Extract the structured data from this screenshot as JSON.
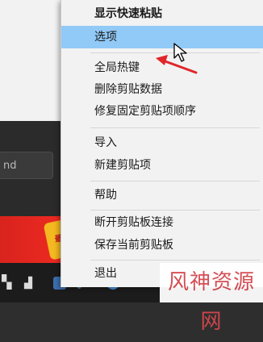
{
  "background_window": {
    "input_text": "nd",
    "banner_text": "最"
  },
  "menu": {
    "items": [
      {
        "label": "显示快速粘贴",
        "bold": true
      },
      {
        "label": "选项",
        "highlighted": true
      },
      {
        "label": "全局热键"
      },
      {
        "label": "删除剪贴数据"
      },
      {
        "label": "修复固定剪贴项顺序"
      },
      {
        "label": "导入"
      },
      {
        "label": "新建剪贴项"
      },
      {
        "label": "帮助"
      },
      {
        "label": "断开剪贴板连接"
      },
      {
        "label": "保存当前剪贴板"
      },
      {
        "label": "退出"
      }
    ]
  },
  "taskbar": {
    "clock_text": "/"
  },
  "watermark": {
    "text": "风神资源网"
  },
  "colors": {
    "menu_background": "#f2f2f2",
    "highlight": "#91c9f7",
    "annotation_arrow": "#e0262b",
    "banner": "#e1261f",
    "taskbar": "#1c1c1c"
  },
  "icons": [
    "pointer-cursor-icon",
    "start-icon",
    "network-icon",
    "volume-icon",
    "app-icon",
    "chrome-icon"
  ]
}
